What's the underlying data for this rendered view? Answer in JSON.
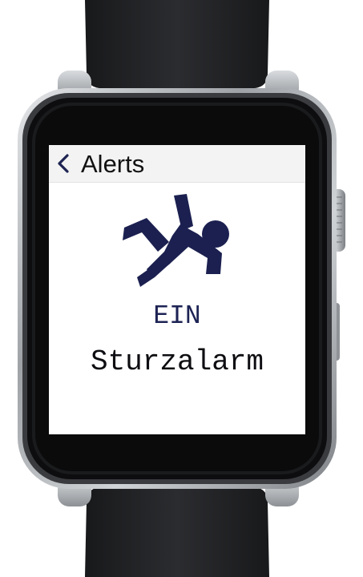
{
  "nav": {
    "back_icon": "chevron-left-icon",
    "title": "Alerts"
  },
  "alert": {
    "icon": "falling-person-icon",
    "line1": "EIN",
    "line2": "Sturzalarm",
    "icon_color": "#1b2050"
  },
  "device": {
    "body_color": "#2a2b2d",
    "band_color": "#1d1e21",
    "frame_color": "#b9bcbf"
  }
}
